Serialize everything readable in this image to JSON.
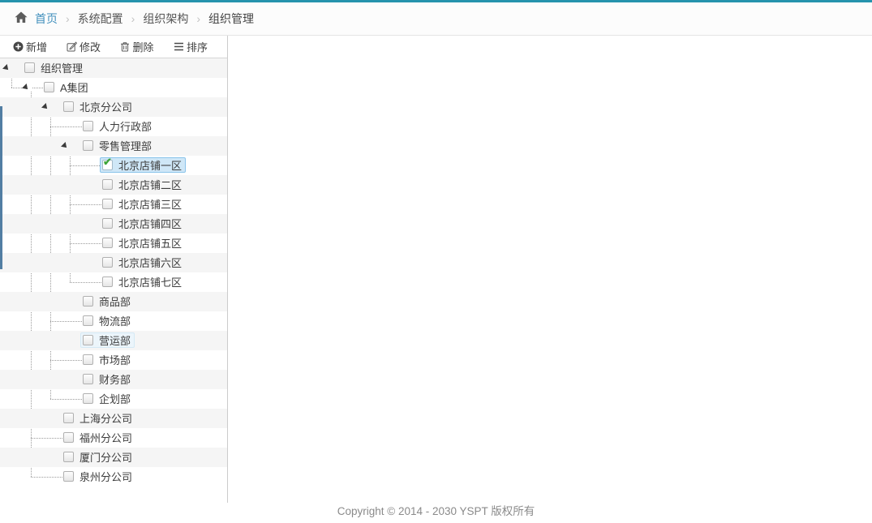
{
  "breadcrumb": {
    "home": "首页",
    "separator": "›",
    "items": [
      "系统配置",
      "组织架构",
      "组织管理"
    ]
  },
  "toolbar": {
    "buttons": [
      {
        "id": "add",
        "label": "新增",
        "icon": "plus-circle-icon"
      },
      {
        "id": "edit",
        "label": "修改",
        "icon": "edit-icon"
      },
      {
        "id": "delete",
        "label": "删除",
        "icon": "trash-icon"
      },
      {
        "id": "sort",
        "label": "排序",
        "icon": "sort-list-icon"
      }
    ]
  },
  "tree": {
    "nodes": [
      {
        "label": "组织管理",
        "level": 0,
        "expanded": true
      },
      {
        "label": "A集团",
        "level": 1,
        "expanded": true
      },
      {
        "label": "北京分公司",
        "level": 2,
        "expanded": true
      },
      {
        "label": "人力行政部",
        "level": 3
      },
      {
        "label": "零售管理部",
        "level": 3,
        "expanded": true
      },
      {
        "label": "北京店铺一区",
        "level": 4,
        "checked": true,
        "selected": true
      },
      {
        "label": "北京店铺二区",
        "level": 4
      },
      {
        "label": "北京店铺三区",
        "level": 4
      },
      {
        "label": "北京店铺四区",
        "level": 4
      },
      {
        "label": "北京店铺五区",
        "level": 4
      },
      {
        "label": "北京店铺六区",
        "level": 4
      },
      {
        "label": "北京店铺七区",
        "level": 4
      },
      {
        "label": "商品部",
        "level": 3
      },
      {
        "label": "物流部",
        "level": 3
      },
      {
        "label": "营运部",
        "level": 3,
        "hovered": true
      },
      {
        "label": "市场部",
        "level": 3
      },
      {
        "label": "财务部",
        "level": 3
      },
      {
        "label": "企划部",
        "level": 3
      },
      {
        "label": "上海分公司",
        "level": 2
      },
      {
        "label": "福州分公司",
        "level": 2
      },
      {
        "label": "厦门分公司",
        "level": 2
      },
      {
        "label": "泉州分公司",
        "level": 2
      }
    ],
    "checkmark_glyph": "✔"
  },
  "footer": {
    "copyright": "Copyright © 2014 - 2030 YSPT 版权所有"
  },
  "colors": {
    "top_border": "#2693ad",
    "breadcrumb_link": "#4290bd",
    "selection_bg": "#cfe7f7",
    "selection_border": "#89c3ea",
    "hover_bg": "#ecf5fb",
    "check_green": "#3fa53a",
    "row_stripe": "#f5f5f5",
    "scroll_thumb": "#527ea3"
  }
}
